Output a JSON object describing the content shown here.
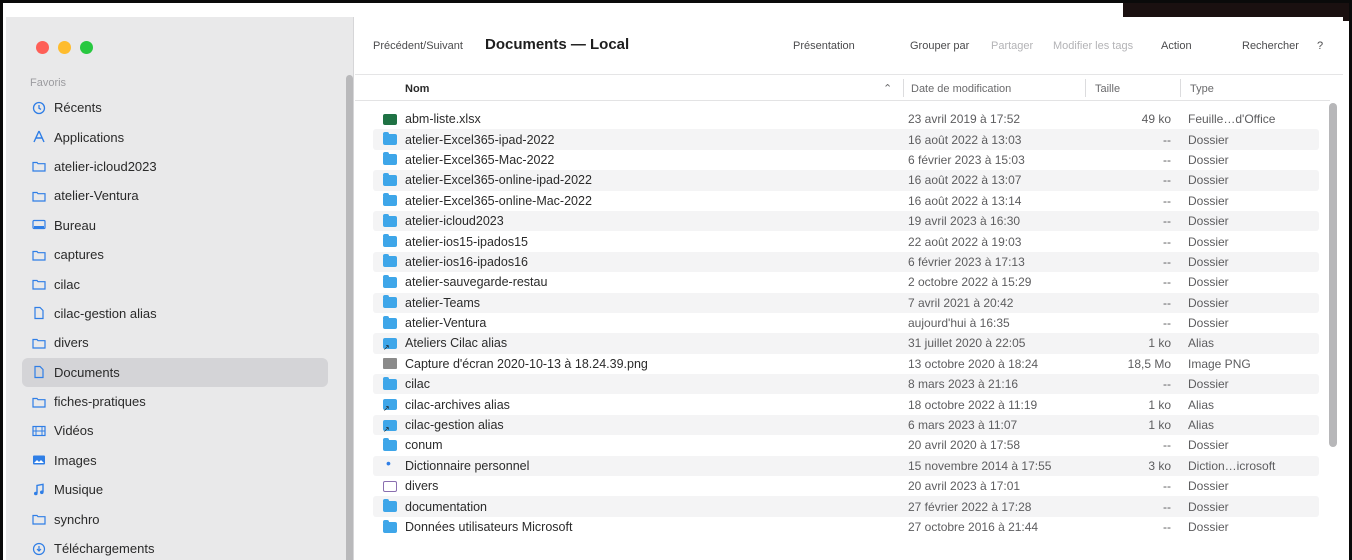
{
  "window": {
    "title": "Documents — Local",
    "nav_label": "Précédent/Suivant"
  },
  "toolbar": {
    "presentation": "Présentation",
    "group_by": "Grouper par",
    "share": "Partager",
    "edit_tags": "Modifier les tags",
    "action": "Action",
    "search": "Rechercher",
    "more": "?"
  },
  "sidebar": {
    "section": "Favoris",
    "items": [
      {
        "label": "Récents",
        "icon": "clock-icon",
        "selected": false
      },
      {
        "label": "Applications",
        "icon": "applications-icon",
        "selected": false
      },
      {
        "label": "atelier-icloud2023",
        "icon": "folder-icon",
        "selected": false
      },
      {
        "label": "atelier-Ventura",
        "icon": "folder-icon",
        "selected": false
      },
      {
        "label": "Bureau",
        "icon": "desktop-icon",
        "selected": false
      },
      {
        "label": "captures",
        "icon": "folder-icon",
        "selected": false
      },
      {
        "label": "cilac",
        "icon": "folder-icon",
        "selected": false
      },
      {
        "label": "cilac-gestion alias",
        "icon": "document-icon",
        "selected": false
      },
      {
        "label": "divers",
        "icon": "folder-icon",
        "selected": false
      },
      {
        "label": "Documents",
        "icon": "document-icon",
        "selected": true
      },
      {
        "label": "fiches-pratiques",
        "icon": "folder-icon",
        "selected": false
      },
      {
        "label": "Vidéos",
        "icon": "film-icon",
        "selected": false
      },
      {
        "label": "Images",
        "icon": "photo-icon",
        "selected": false
      },
      {
        "label": "Musique",
        "icon": "music-icon",
        "selected": false
      },
      {
        "label": "synchro",
        "icon": "folder-icon",
        "selected": false
      },
      {
        "label": "Téléchargements",
        "icon": "download-icon",
        "selected": false
      }
    ]
  },
  "columns": {
    "name": "Nom",
    "date": "Date de modification",
    "size": "Taille",
    "type": "Type"
  },
  "files": [
    {
      "name": "abm-liste.xlsx",
      "date": "23 avril 2019 à 17:52",
      "size": "49 ko",
      "type": "Feuille…d'Office",
      "icon": "xlsx"
    },
    {
      "name": "atelier-Excel365-ipad-2022",
      "date": "16 août 2022 à 13:03",
      "size": "--",
      "type": "Dossier",
      "icon": "folder"
    },
    {
      "name": "atelier-Excel365-Mac-2022",
      "date": "6 février 2023 à 15:03",
      "size": "--",
      "type": "Dossier",
      "icon": "folder"
    },
    {
      "name": "atelier-Excel365-online-ipad-2022",
      "date": "16 août 2022 à 13:07",
      "size": "--",
      "type": "Dossier",
      "icon": "folder"
    },
    {
      "name": "atelier-Excel365-online-Mac-2022",
      "date": "16 août 2022 à 13:14",
      "size": "--",
      "type": "Dossier",
      "icon": "folder"
    },
    {
      "name": "atelier-icloud2023",
      "date": "19 avril 2023 à 16:30",
      "size": "--",
      "type": "Dossier",
      "icon": "folder"
    },
    {
      "name": "atelier-ios15-ipados15",
      "date": "22 août 2022 à 19:03",
      "size": "--",
      "type": "Dossier",
      "icon": "folder"
    },
    {
      "name": "atelier-ios16-ipados16",
      "date": "6 février 2023 à 17:13",
      "size": "--",
      "type": "Dossier",
      "icon": "folder"
    },
    {
      "name": "atelier-sauvegarde-restau",
      "date": "2 octobre 2022 à 15:29",
      "size": "--",
      "type": "Dossier",
      "icon": "folder"
    },
    {
      "name": "atelier-Teams",
      "date": "7 avril 2021 à 20:42",
      "size": "--",
      "type": "Dossier",
      "icon": "folder"
    },
    {
      "name": "atelier-Ventura",
      "date": "aujourd'hui à 16:35",
      "size": "--",
      "type": "Dossier",
      "icon": "folder"
    },
    {
      "name": "Ateliers Cilac alias",
      "date": "31 juillet 2020 à 22:05",
      "size": "1 ko",
      "type": "Alias",
      "icon": "alias"
    },
    {
      "name": "Capture d'écran 2020-10-13 à 18.24.39.png",
      "date": "13 octobre 2020 à 18:24",
      "size": "18,5 Mo",
      "type": "Image PNG",
      "icon": "png"
    },
    {
      "name": "cilac",
      "date": "8 mars 2023 à 21:16",
      "size": "--",
      "type": "Dossier",
      "icon": "folder"
    },
    {
      "name": "cilac-archives alias",
      "date": "18 octobre 2022 à 11:19",
      "size": "1 ko",
      "type": "Alias",
      "icon": "alias"
    },
    {
      "name": "cilac-gestion alias",
      "date": "6 mars 2023 à 11:07",
      "size": "1 ko",
      "type": "Alias",
      "icon": "alias"
    },
    {
      "name": "conum",
      "date": "20 avril 2020 à 17:58",
      "size": "--",
      "type": "Dossier",
      "icon": "folder"
    },
    {
      "name": "Dictionnaire personnel",
      "date": "15 novembre 2014 à 17:55",
      "size": "3 ko",
      "type": "Diction…icrosoft",
      "icon": "doc"
    },
    {
      "name": "divers",
      "date": "20 avril 2023 à 17:01",
      "size": "--",
      "type": "Dossier",
      "icon": "divers"
    },
    {
      "name": "documentation",
      "date": "27 février 2022 à 17:28",
      "size": "--",
      "type": "Dossier",
      "icon": "folder"
    },
    {
      "name": "Données utilisateurs Microsoft",
      "date": "27 octobre 2016 à 21:44",
      "size": "--",
      "type": "Dossier",
      "icon": "folder"
    }
  ],
  "colors": {
    "accent": "#2f7ee6",
    "folder": "#3ea6e9",
    "sidebar_bg": "#e9e9ea",
    "selected_bg": "#d4d4d7"
  }
}
